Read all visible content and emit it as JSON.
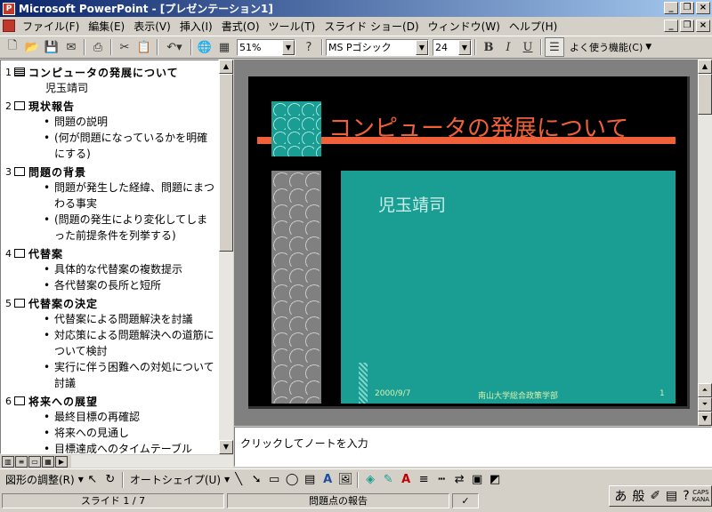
{
  "window": {
    "title": "Microsoft PowerPoint - [プレゼンテーション1]",
    "app_icon": "P"
  },
  "menu": [
    "ファイル(F)",
    "編集(E)",
    "表示(V)",
    "挿入(I)",
    "書式(O)",
    "ツール(T)",
    "スライド ショー(D)",
    "ウィンドウ(W)",
    "ヘルプ(H)"
  ],
  "toolbar": {
    "zoom": "51%",
    "font": "MS Pゴシック",
    "font_size": "24",
    "bold_label": "B",
    "italic_label": "I",
    "underline_label": "U",
    "frequent_features": "よく使う機能(C)"
  },
  "outline": {
    "slides": [
      {
        "num": "1",
        "title": "コンピュータの発展について",
        "subtitle": "児玉靖司",
        "bullets": []
      },
      {
        "num": "2",
        "title": "現状報告",
        "bullets": [
          "問題の説明",
          "(何が問題になっているかを明確にする)"
        ]
      },
      {
        "num": "3",
        "title": "問題の背景",
        "bullets": [
          "問題が発生した経緯、問題にまつわる事実",
          "(問題の発生により変化してしまった前提条件を列挙する)"
        ]
      },
      {
        "num": "4",
        "title": "代替案",
        "bullets": [
          "具体的な代替案の複数提示",
          "各代替案の長所と短所"
        ]
      },
      {
        "num": "5",
        "title": "代替案の決定",
        "bullets": [
          "代替案による問題解決を討議",
          "対応策による問題解決への道筋について検討",
          "実行に伴う困難への対処について討議"
        ]
      },
      {
        "num": "6",
        "title": "将来への展望",
        "bullets": [
          "最終目標の再確認",
          "将来への見通し",
          "目標達成へのタイムテーブル"
        ]
      }
    ],
    "bullet_char": "•"
  },
  "slide": {
    "title": "コンピュータの発展について",
    "subtitle": "児玉靖司",
    "footer_date": "2000/9/7",
    "footer_text": "南山大学総合政策学部",
    "footer_page": "1"
  },
  "notes": {
    "placeholder": "クリックしてノートを入力"
  },
  "drawbar": {
    "draw_label": "図形の調整(R)",
    "autoshape_label": "オートシェイプ(U)"
  },
  "statusbar": {
    "slide_pos": "スライド 1 / 7",
    "design": "問題点の報告"
  },
  "ime": {
    "mode": "あ",
    "conv": "般",
    "caps": "CAPS",
    "kana": "KANA"
  },
  "colors": {
    "teal": "#1a9e94",
    "accent": "#f0613a",
    "title_gradient_start": "#0a246a"
  }
}
